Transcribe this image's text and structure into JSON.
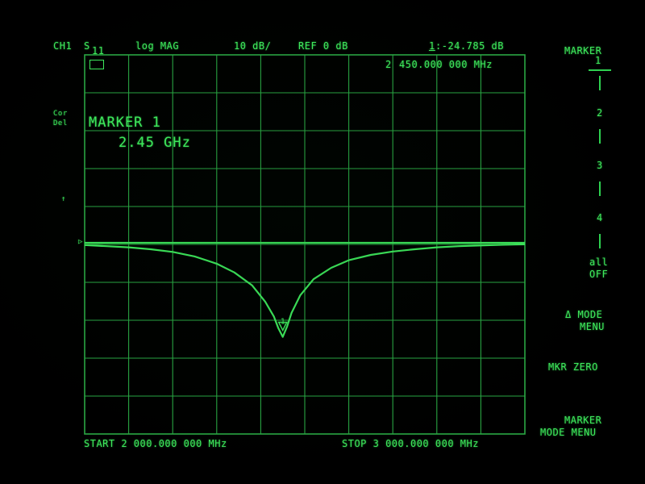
{
  "header": {
    "channel": "CH1",
    "param": "S",
    "param_sub": "11",
    "format": "log MAG",
    "scale": "10 dB/",
    "ref": "REF 0 dB",
    "marker_readout_num": "1",
    "marker_readout_val": ":-24.785 dB",
    "marker_freq_label": "2",
    "marker_freq_val": "450.000 000 MHz"
  },
  "left_labels": {
    "cor": "Cor",
    "del": "Del",
    "arrow": "↑",
    "ref_arrow": "▷"
  },
  "active_marker": {
    "title": "MARKER 1",
    "freq": "2.45 GHz"
  },
  "footer": {
    "start": "START 2 000.000 000 MHz",
    "stop": "STOP 3 000.000 000 MHz"
  },
  "softkeys": {
    "title": "MARKER",
    "m1": "1",
    "m2": "2",
    "m3": "3",
    "m4": "4",
    "all": "all",
    "off": "OFF",
    "delta_mode": "Δ MODE",
    "delta_menu": "MENU",
    "mkr_zero": "MKR ZERO",
    "marker_mode1": "MARKER",
    "marker_mode2": "MODE MENU"
  },
  "colors": {
    "trace": "#3ee85c",
    "grid": "#2aa844",
    "background": "#000000"
  },
  "chart_data": {
    "type": "line",
    "title": "",
    "xlabel": "",
    "ylabel": "",
    "x_unit": "MHz",
    "y_unit": "dB",
    "xlim": [
      2000,
      3000
    ],
    "ylim": [
      -50,
      0
    ],
    "series": [
      {
        "x": [
          2000,
          2050,
          2100,
          2150,
          2200,
          2250,
          2300,
          2340,
          2380,
          2410,
          2430,
          2440,
          2450,
          2460,
          2470,
          2490,
          2520,
          2560,
          2600,
          2650,
          2700,
          2750,
          2800,
          2850,
          2900,
          2950,
          3000
        ],
        "values": [
          -0.6,
          -0.9,
          -1.2,
          -1.7,
          -2.4,
          -3.6,
          -5.5,
          -7.8,
          -11.2,
          -15.5,
          -19.5,
          -22.5,
          -24.8,
          -22.0,
          -18.5,
          -13.8,
          -9.6,
          -6.6,
          -4.6,
          -3.2,
          -2.3,
          -1.7,
          -1.2,
          -0.9,
          -0.7,
          -0.5,
          -0.4
        ]
      },
      {
        "x": [
          2000,
          3000
        ],
        "values": [
          0,
          0
        ]
      }
    ],
    "markers": [
      {
        "label": "1",
        "x": 2450,
        "y": -24.785
      }
    ],
    "grid": true
  }
}
